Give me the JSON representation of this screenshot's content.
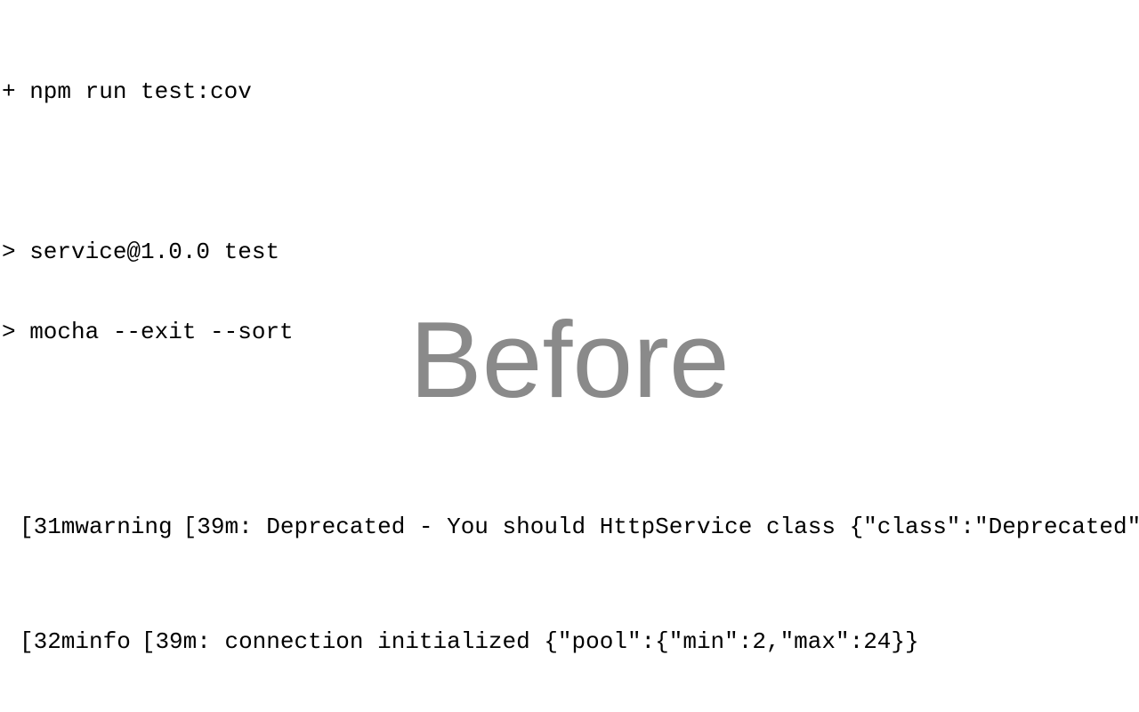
{
  "terminal": {
    "command_line": "+ npm run test:cov",
    "script_lines": [
      "> service@1.0.0 test",
      "> mocha --exit --sort"
    ],
    "log_lines": [
      {
        "color_code_start": "[31m",
        "level": "warning",
        "color_code_end": "[39m",
        "message": ": Deprecated - You should HttpService class {\"class\":\"Deprecated\","
      },
      {
        "color_code_start": "[32m",
        "level": "info",
        "color_code_end": "[39m",
        "message": ": connection initialized {\"pool\":{\"min\":2,\"max\":24}}"
      }
    ]
  },
  "overlay": {
    "label": "Before",
    "color": "#8a8a8a"
  },
  "colors": {
    "background": "#ffffff",
    "text": "#000000"
  }
}
